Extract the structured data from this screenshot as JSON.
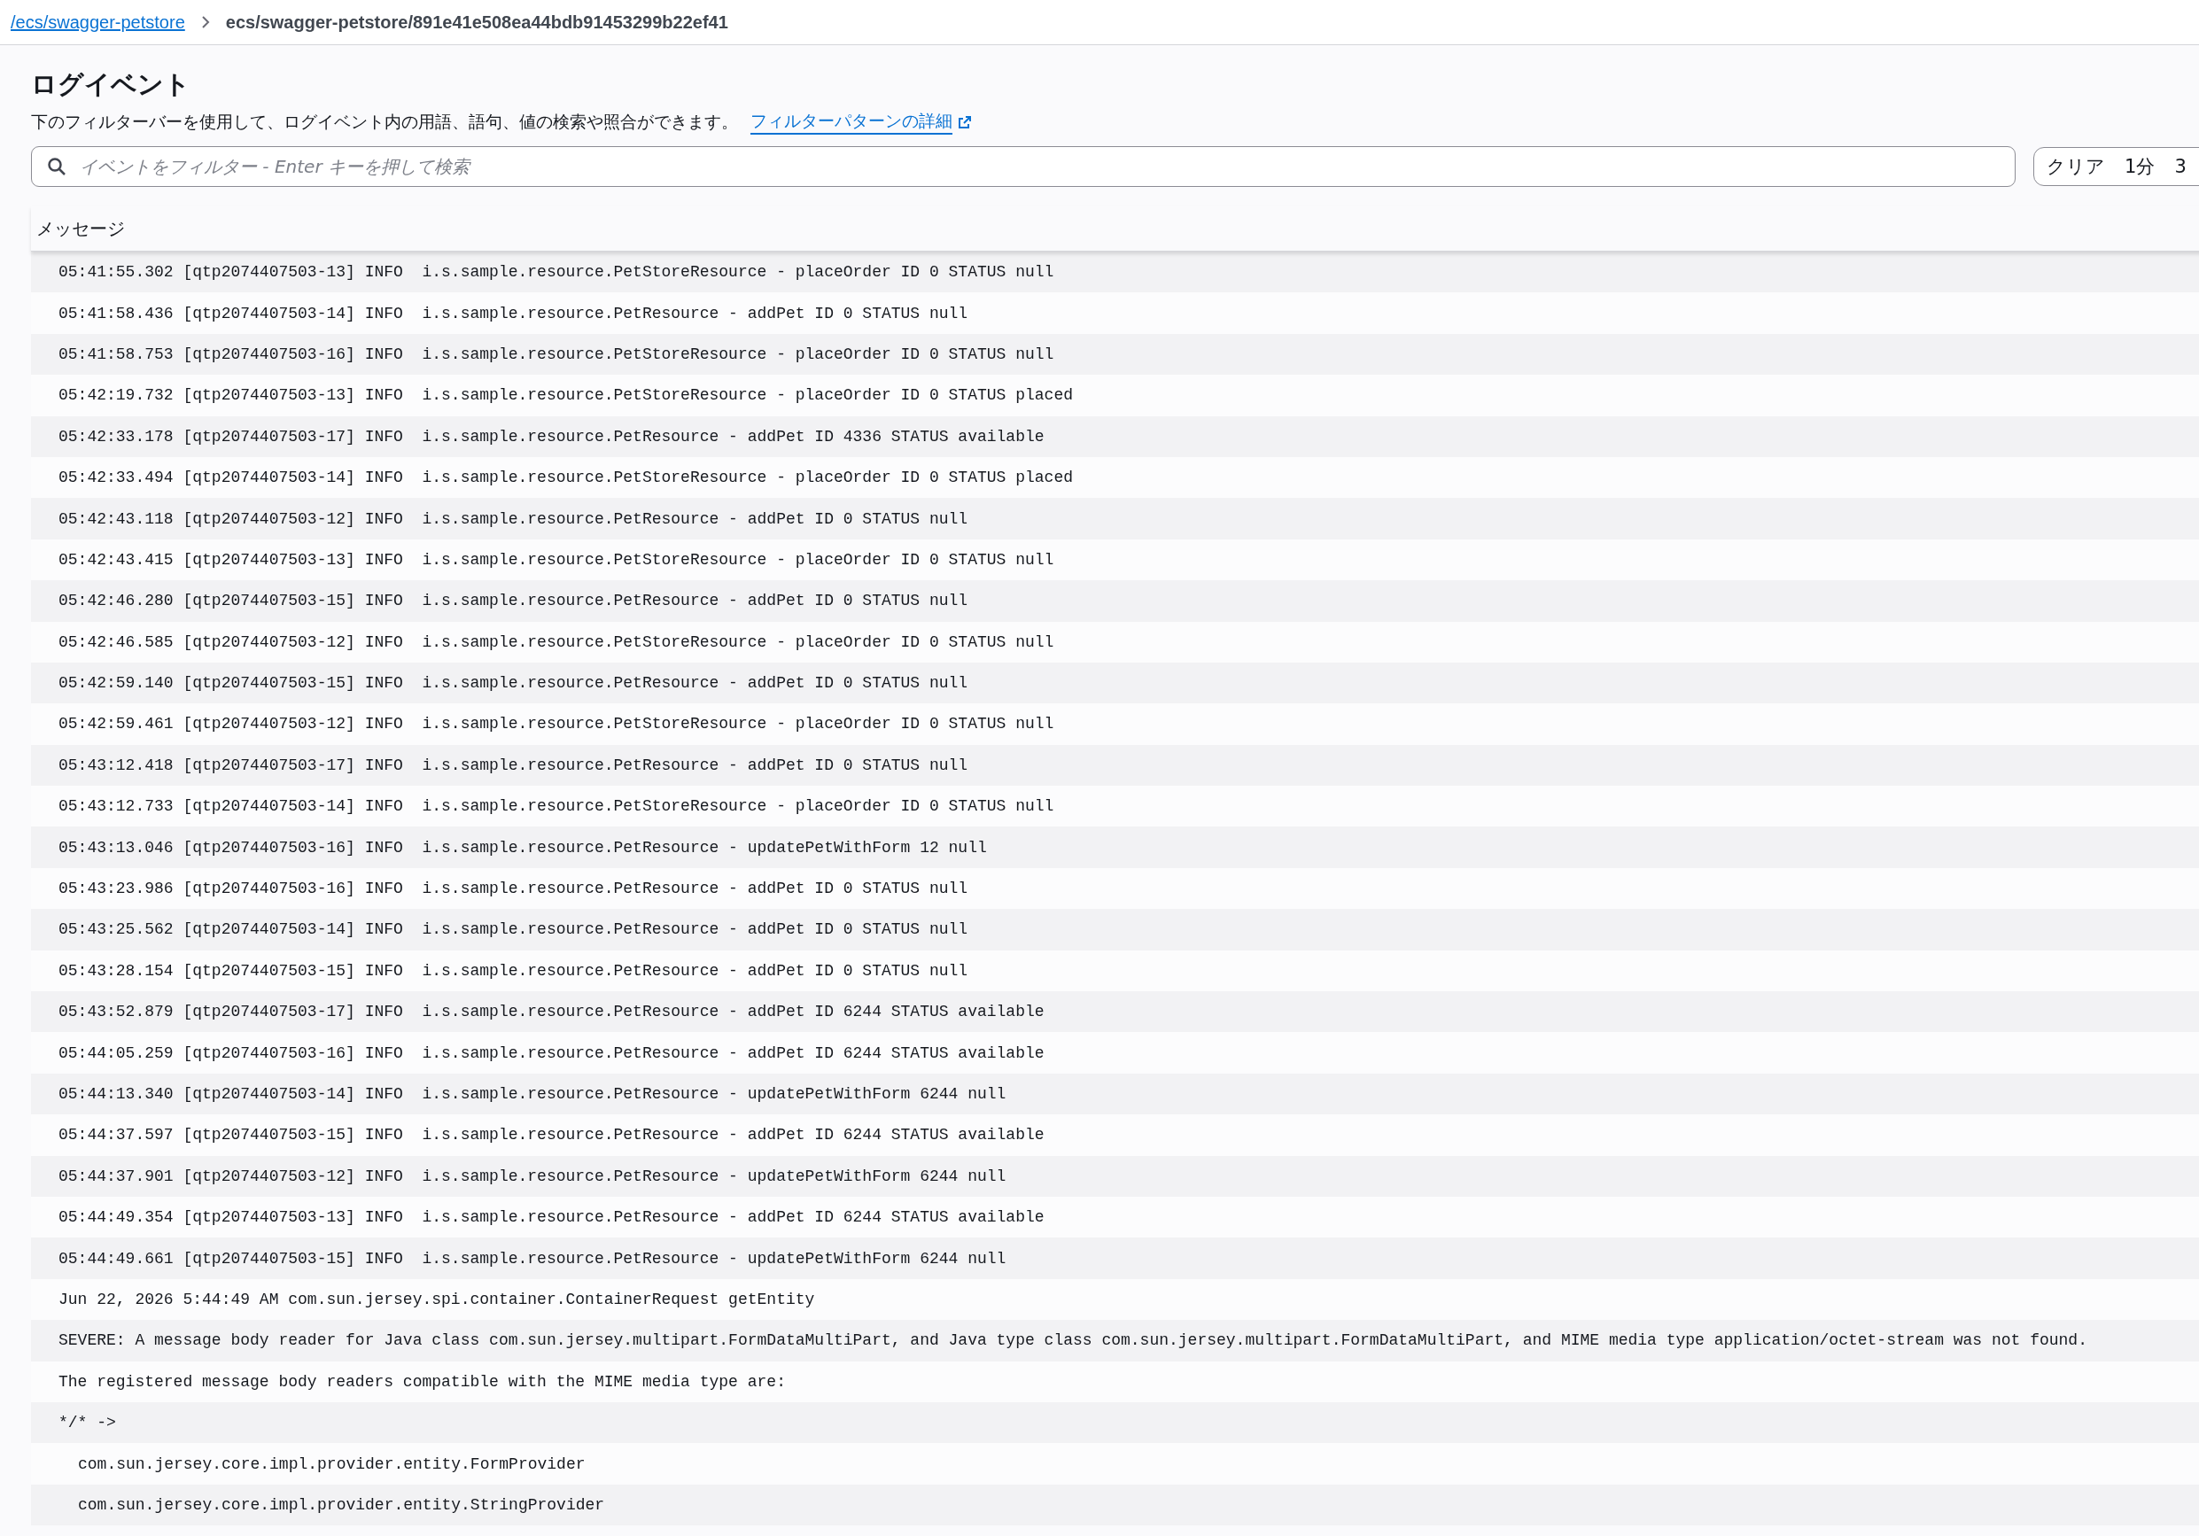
{
  "breadcrumb": [
    {
      "label": "/ecs/swagger-petstore",
      "kind": "link"
    },
    {
      "label": "ecs/swagger-petstore/891e41e508ea44bdb91453299b22ef41",
      "kind": "current"
    }
  ],
  "section": {
    "title": "ログイベント",
    "description": "下のフィルターバーを使用して、ログイベント内の用語、語句、値の検索や照合ができます。",
    "link": "フィルターパターンの詳細"
  },
  "search": {
    "placeholder": "イベントをフィルター - Enter キーを押して検索"
  },
  "time_range": [
    "クリア",
    "1分",
    "3"
  ],
  "table": {
    "columns": [
      "メッセージ"
    ],
    "rows": [
      {
        "kind": "line",
        "text": "05:41:55.302 [qtp2074407503-13] INFO  i.s.sample.resource.PetStoreResource - placeOrder ID 0 STATUS null"
      },
      {
        "kind": "line",
        "text": "05:41:58.436 [qtp2074407503-14] INFO  i.s.sample.resource.PetResource - addPet ID 0 STATUS null"
      },
      {
        "kind": "line",
        "text": "05:41:58.753 [qtp2074407503-16] INFO  i.s.sample.resource.PetStoreResource - placeOrder ID 0 STATUS null"
      },
      {
        "kind": "line",
        "text": "05:42:19.732 [qtp2074407503-13] INFO  i.s.sample.resource.PetStoreResource - placeOrder ID 0 STATUS placed"
      },
      {
        "kind": "line",
        "text": "05:42:33.178 [qtp2074407503-17] INFO  i.s.sample.resource.PetResource - addPet ID 4336 STATUS available"
      },
      {
        "kind": "line",
        "text": "05:42:33.494 [qtp2074407503-14] INFO  i.s.sample.resource.PetStoreResource - placeOrder ID 0 STATUS placed"
      },
      {
        "kind": "line",
        "text": "05:42:43.118 [qtp2074407503-12] INFO  i.s.sample.resource.PetResource - addPet ID 0 STATUS null"
      },
      {
        "kind": "line",
        "text": "05:42:43.415 [qtp2074407503-13] INFO  i.s.sample.resource.PetStoreResource - placeOrder ID 0 STATUS null"
      },
      {
        "kind": "line",
        "text": "05:42:46.280 [qtp2074407503-15] INFO  i.s.sample.resource.PetResource - addPet ID 0 STATUS null"
      },
      {
        "kind": "line",
        "text": "05:42:46.585 [qtp2074407503-12] INFO  i.s.sample.resource.PetStoreResource - placeOrder ID 0 STATUS null"
      },
      {
        "kind": "line",
        "text": "05:42:59.140 [qtp2074407503-15] INFO  i.s.sample.resource.PetResource - addPet ID 0 STATUS null"
      },
      {
        "kind": "line",
        "text": "05:42:59.461 [qtp2074407503-12] INFO  i.s.sample.resource.PetStoreResource - placeOrder ID 0 STATUS null"
      },
      {
        "kind": "line",
        "text": "05:43:12.418 [qtp2074407503-17] INFO  i.s.sample.resource.PetResource - addPet ID 0 STATUS null"
      },
      {
        "kind": "line",
        "text": "05:43:12.733 [qtp2074407503-14] INFO  i.s.sample.resource.PetStoreResource - placeOrder ID 0 STATUS null"
      },
      {
        "kind": "line",
        "text": "05:43:13.046 [qtp2074407503-16] INFO  i.s.sample.resource.PetResource - updatePetWithForm 12 null"
      },
      {
        "kind": "line",
        "text": "05:43:23.986 [qtp2074407503-16] INFO  i.s.sample.resource.PetResource - addPet ID 0 STATUS null"
      },
      {
        "kind": "line",
        "text": "05:43:25.562 [qtp2074407503-14] INFO  i.s.sample.resource.PetResource - addPet ID 0 STATUS null"
      },
      {
        "kind": "line",
        "text": "05:43:28.154 [qtp2074407503-15] INFO  i.s.sample.resource.PetResource - addPet ID 0 STATUS null"
      },
      {
        "kind": "line",
        "text": "05:43:52.879 [qtp2074407503-17] INFO  i.s.sample.resource.PetResource - addPet ID 6244 STATUS available"
      },
      {
        "kind": "line",
        "text": "05:44:05.259 [qtp2074407503-16] INFO  i.s.sample.resource.PetResource - addPet ID 6244 STATUS available"
      },
      {
        "kind": "line",
        "text": "05:44:13.340 [qtp2074407503-14] INFO  i.s.sample.resource.PetResource - updatePetWithForm 6244 null"
      },
      {
        "kind": "line",
        "text": "05:44:37.597 [qtp2074407503-15] INFO  i.s.sample.resource.PetResource - addPet ID 6244 STATUS available"
      },
      {
        "kind": "line",
        "text": "05:44:37.901 [qtp2074407503-12] INFO  i.s.sample.resource.PetResource - updatePetWithForm 6244 null"
      },
      {
        "kind": "line",
        "text": "05:44:49.354 [qtp2074407503-13] INFO  i.s.sample.resource.PetResource - addPet ID 6244 STATUS available"
      },
      {
        "kind": "line",
        "text": "05:44:49.661 [qtp2074407503-15] INFO  i.s.sample.resource.PetResource - updatePetWithForm 6244 null"
      },
      {
        "kind": "line",
        "text": "Jun 22, 2026 5:44:49 AM com.sun.jersey.spi.container.ContainerRequest getEntity"
      },
      {
        "kind": "line",
        "text": "SEVERE: A message body reader for Java class com.sun.jersey.multipart.FormDataMultiPart, and Java type class com.sun.jersey.multipart.FormDataMultiPart, and MIME media type application/octet-stream was not found."
      },
      {
        "kind": "line",
        "text": "The registered message body readers compatible with the MIME media type are:"
      },
      {
        "kind": "line",
        "text": "*/* ->"
      },
      {
        "kind": "indented",
        "text": "com.sun.jersey.core.impl.provider.entity.FormProvider"
      },
      {
        "kind": "indented",
        "text": "com.sun.jersey.core.impl.provider.entity.StringProvider"
      }
    ]
  }
}
